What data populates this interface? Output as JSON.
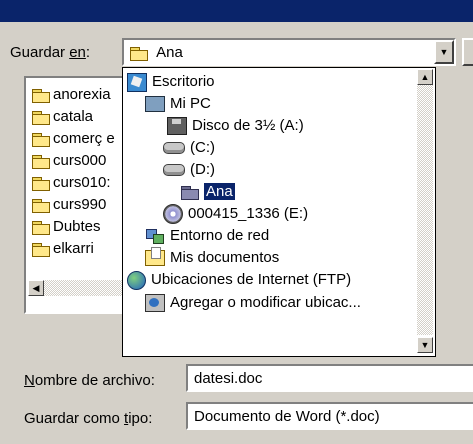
{
  "dialog": {
    "save_in_label_pre": "Guardar ",
    "save_in_label_u": "en",
    "save_in_label_post": ":",
    "save_in_value": "Ana",
    "filename_label_u": "N",
    "filename_label_post": "ombre de archivo:",
    "filename_value": "datesi.doc",
    "filetype_label_pre": "Guardar como ",
    "filetype_label_u": "t",
    "filetype_label_post": "ipo:",
    "filetype_value": "Documento de Word (*.doc)"
  },
  "file_list": {
    "items": [
      "anorexia",
      "catala",
      "comerç e",
      "curs000",
      "curs010:",
      "curs990",
      "Dubtes",
      "elkarri"
    ]
  },
  "tree": {
    "items": [
      {
        "label": "Escritorio",
        "icon": "desktop-icon"
      },
      {
        "label": "Mi PC",
        "icon": "computer-icon"
      },
      {
        "label": "Disco de 3½ (A:)",
        "icon": "floppy-drive-icon"
      },
      {
        "label": "(C:)",
        "icon": "hard-drive-icon"
      },
      {
        "label": "(D:)",
        "icon": "hard-drive-icon"
      },
      {
        "label": "Ana",
        "icon": "open-folder-icon"
      },
      {
        "label": "000415_1336 (E:)",
        "icon": "cd-drive-icon"
      },
      {
        "label": "Entorno de red",
        "icon": "network-icon"
      },
      {
        "label": "Mis documentos",
        "icon": "my-documents-icon"
      },
      {
        "label": "Ubicaciones de Internet (FTP)",
        "icon": "internet-globe-icon"
      },
      {
        "label": "Agregar o modificar ubicac...",
        "icon": "add-ftp-icon"
      }
    ]
  },
  "icons": {
    "combo_arrow": "▼",
    "scroll_up": "▲",
    "scroll_down": "▼",
    "scroll_left": "◀"
  },
  "colors": {
    "titlebar": "#0a246a",
    "selection": "#0a246a",
    "face": "#d4d0c8"
  }
}
